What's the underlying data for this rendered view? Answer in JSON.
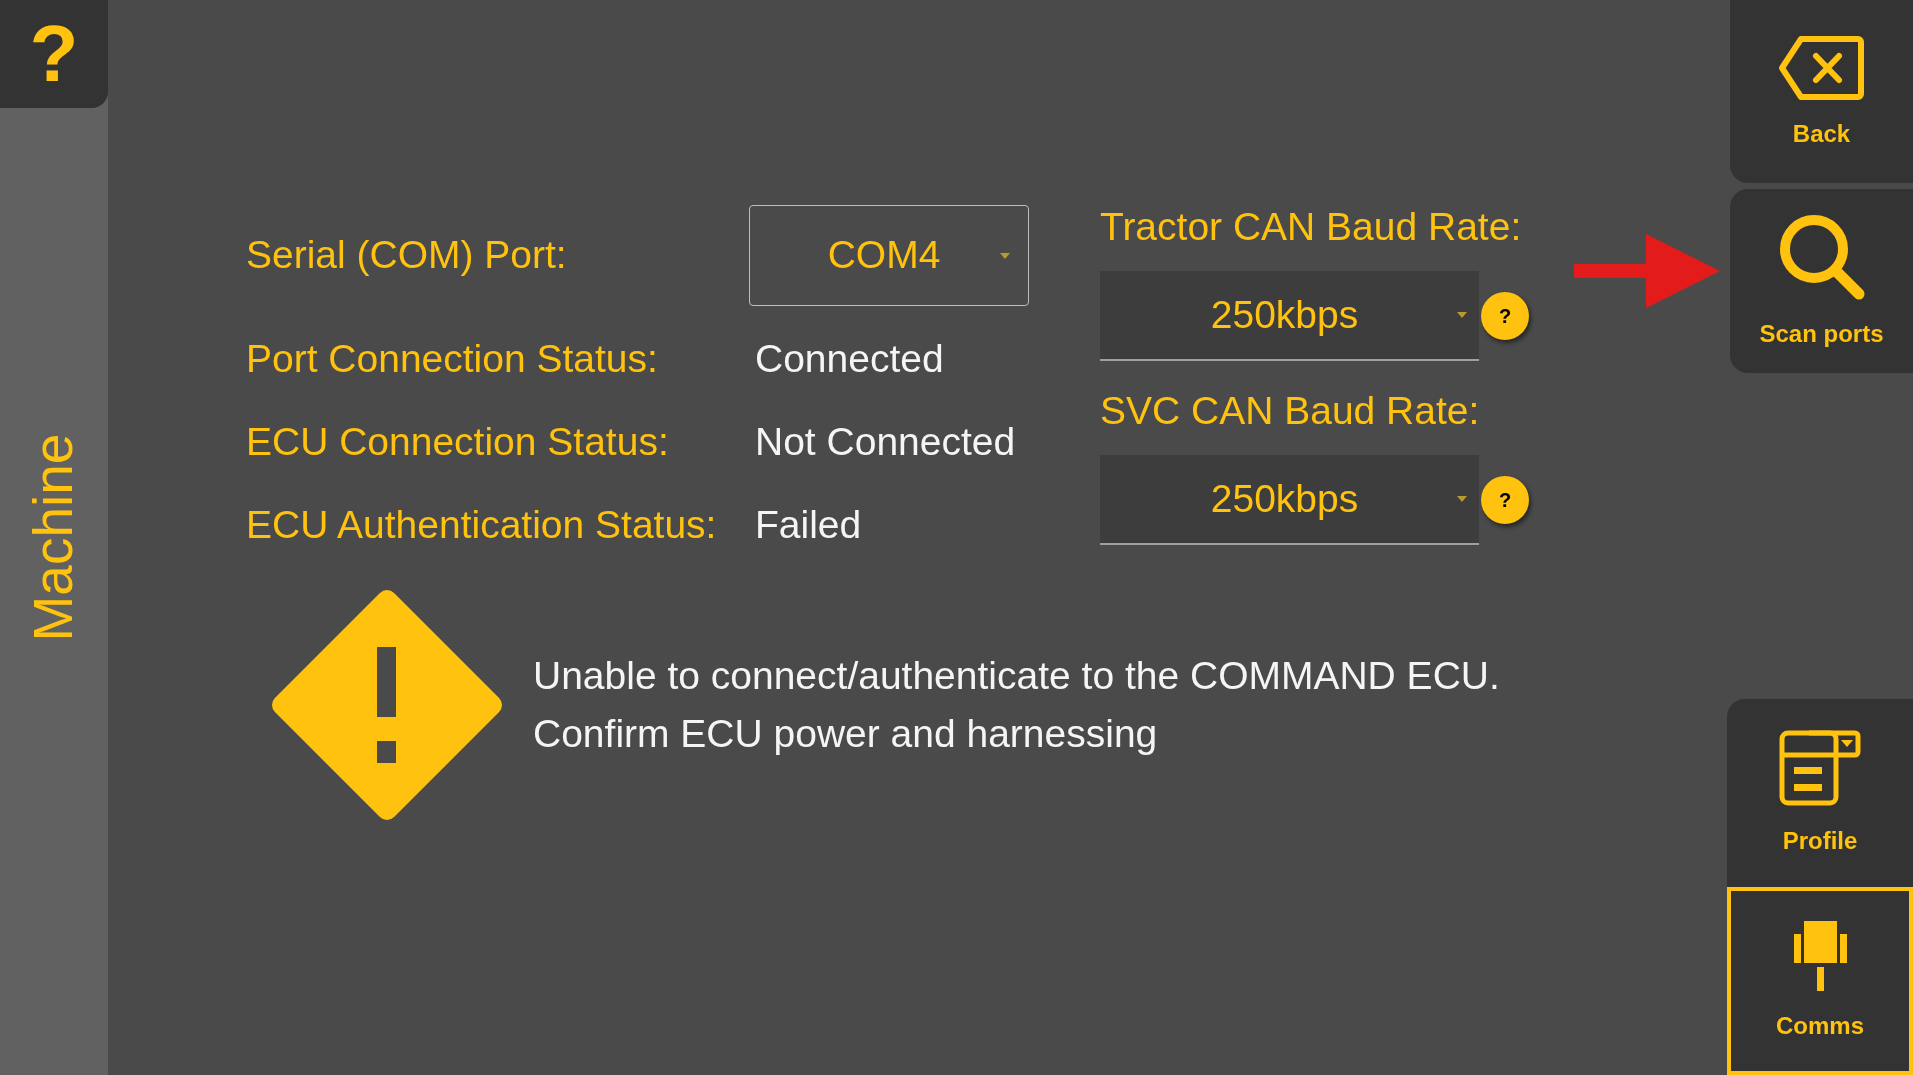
{
  "help_button": {
    "label": "?"
  },
  "sidebar": {
    "title": "Machine"
  },
  "serial_port": {
    "label": "Serial (COM) Port:",
    "value": "COM4"
  },
  "status_rows": [
    {
      "label": "Port Connection Status:",
      "value": "Connected"
    },
    {
      "label": "ECU Connection Status:",
      "value": "Not Connected"
    },
    {
      "label": "ECU Authentication Status:",
      "value": "Failed"
    }
  ],
  "baud_rates": [
    {
      "label": "Tractor CAN Baud Rate:",
      "value": "250kbps",
      "help": "?"
    },
    {
      "label": "SVC CAN Baud Rate:",
      "value": "250kbps",
      "help": "?"
    }
  ],
  "alert": {
    "lines": [
      "Unable to connect/authenticate to the COMMAND ECU.",
      "Confirm ECU power and harnessing"
    ]
  },
  "actions": [
    {
      "label": "Back"
    },
    {
      "label": "Scan ports"
    }
  ],
  "nav_tabs": [
    {
      "label": "Profile",
      "selected": false
    },
    {
      "label": "Comms",
      "selected": true
    }
  ]
}
